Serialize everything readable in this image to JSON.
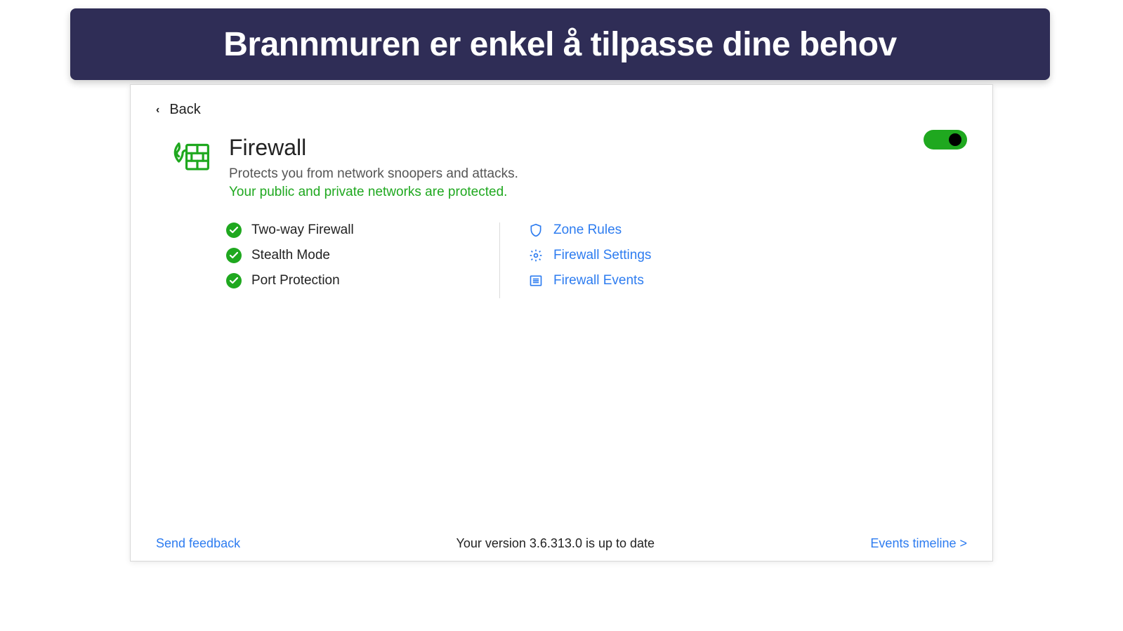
{
  "banner": {
    "text": "Brannmuren er enkel å tilpasse dine behov"
  },
  "back": {
    "label": "Back"
  },
  "firewall": {
    "title": "Firewall",
    "subtitle": "Protects you from network snoopers and attacks.",
    "status": "Your public and private networks are protected.",
    "enabled": true
  },
  "features": [
    {
      "label": "Two-way Firewall"
    },
    {
      "label": "Stealth Mode"
    },
    {
      "label": "Port Protection"
    }
  ],
  "links": [
    {
      "label": "Zone Rules",
      "icon": "shield"
    },
    {
      "label": "Firewall Settings",
      "icon": "gear"
    },
    {
      "label": "Firewall Events",
      "icon": "list"
    }
  ],
  "footer": {
    "feedback": "Send feedback",
    "version": "Your version 3.6.313.0 is up to date",
    "events": "Events timeline >"
  },
  "colors": {
    "accent_green": "#1fa81f",
    "link_blue": "#2d7cf0",
    "banner_bg": "#2f2d56"
  }
}
